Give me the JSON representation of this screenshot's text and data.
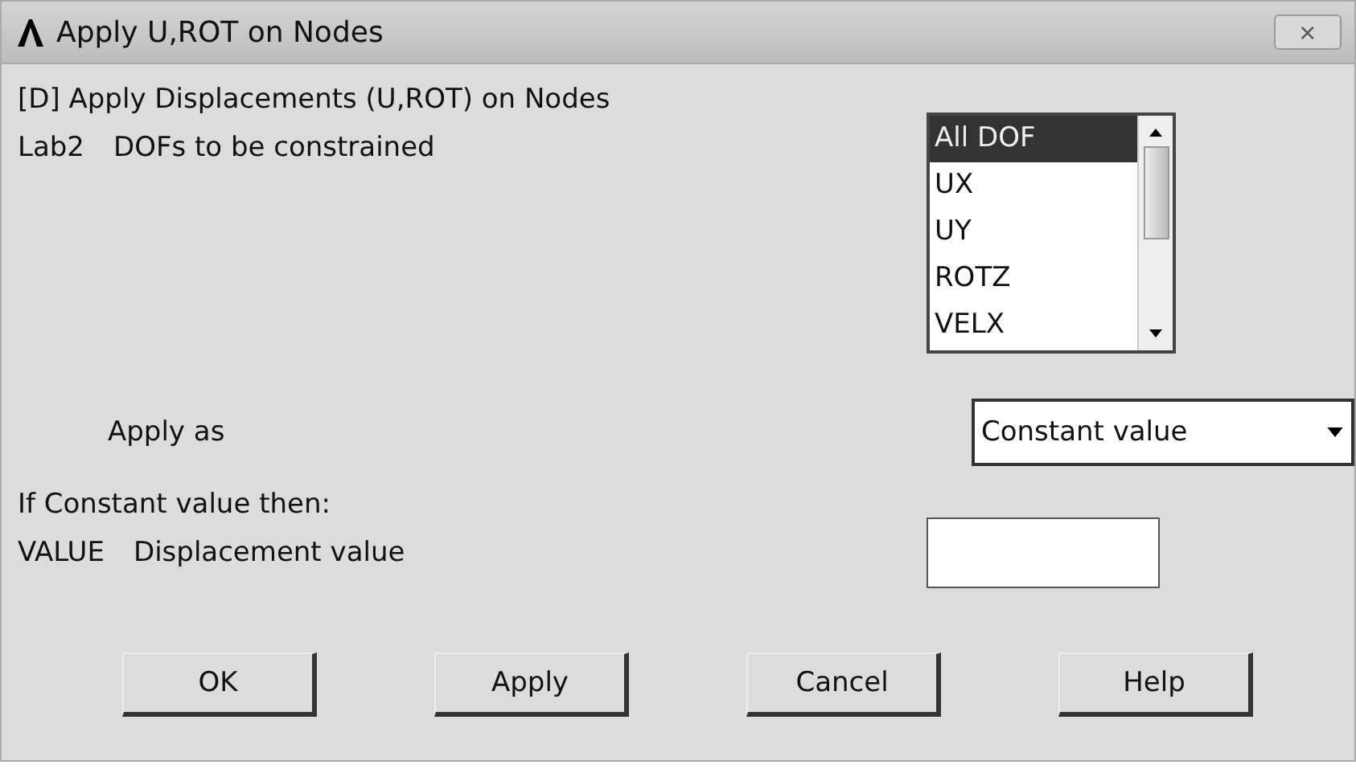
{
  "window": {
    "title": "Apply U,ROT on Nodes",
    "close": "⨯"
  },
  "heading": "[D]  Apply Displacements (U,ROT) on Nodes",
  "dof": {
    "code": "Lab2",
    "label": "DOFs to be constrained",
    "items": [
      {
        "label": "All DOF",
        "selected": true
      },
      {
        "label": "UX",
        "selected": false
      },
      {
        "label": "UY",
        "selected": false
      },
      {
        "label": "ROTZ",
        "selected": false
      },
      {
        "label": "VELX",
        "selected": false
      }
    ]
  },
  "apply_as": {
    "label": "Apply as",
    "value": "Constant value"
  },
  "note": "If Constant value then:",
  "value": {
    "code": "VALUE",
    "label": "Displacement value"
  },
  "buttons": [
    "OK",
    "Apply",
    "Cancel",
    "Help"
  ]
}
